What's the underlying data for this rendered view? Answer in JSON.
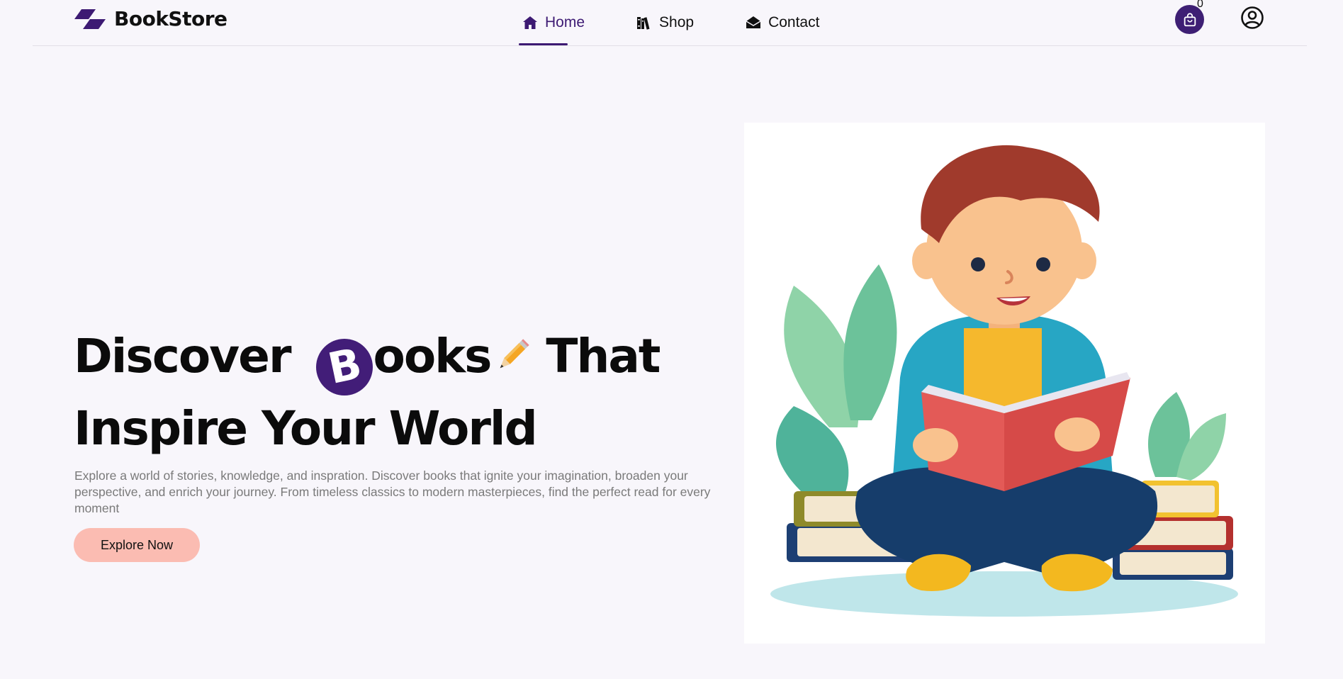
{
  "brand": {
    "name": "BookStore",
    "icon": "bookstore-logo-icon"
  },
  "nav": {
    "items": [
      {
        "label": "Home",
        "icon": "home-icon",
        "active": true
      },
      {
        "label": "Shop",
        "icon": "books-shelf-icon",
        "active": false
      },
      {
        "label": "Contact",
        "icon": "envelope-open-icon",
        "active": false
      }
    ],
    "cart": {
      "icon": "shopping-bag-icon",
      "count": "0"
    },
    "user": {
      "icon": "user-circle-icon"
    }
  },
  "hero": {
    "title_part1": "Discover ",
    "title_badge_letter": "B",
    "title_part2": "ooks",
    "title_part3": "That",
    "title_line2": "Inspire Your World",
    "description": "Explore a world of stories, knowledge, and inspration. Discover books that ignite your imagination, broaden your perspective, and enrich your journey. From timeless classics to modern masterpieces, find the perfect read for every moment",
    "cta_label": "Explore Now",
    "illustration": "boy-reading-book-illustration"
  },
  "colors": {
    "background": "#f8f6fb",
    "accent": "#3d1a73",
    "cta": "#fbbcb2",
    "muted_text": "#7a7a7a"
  }
}
